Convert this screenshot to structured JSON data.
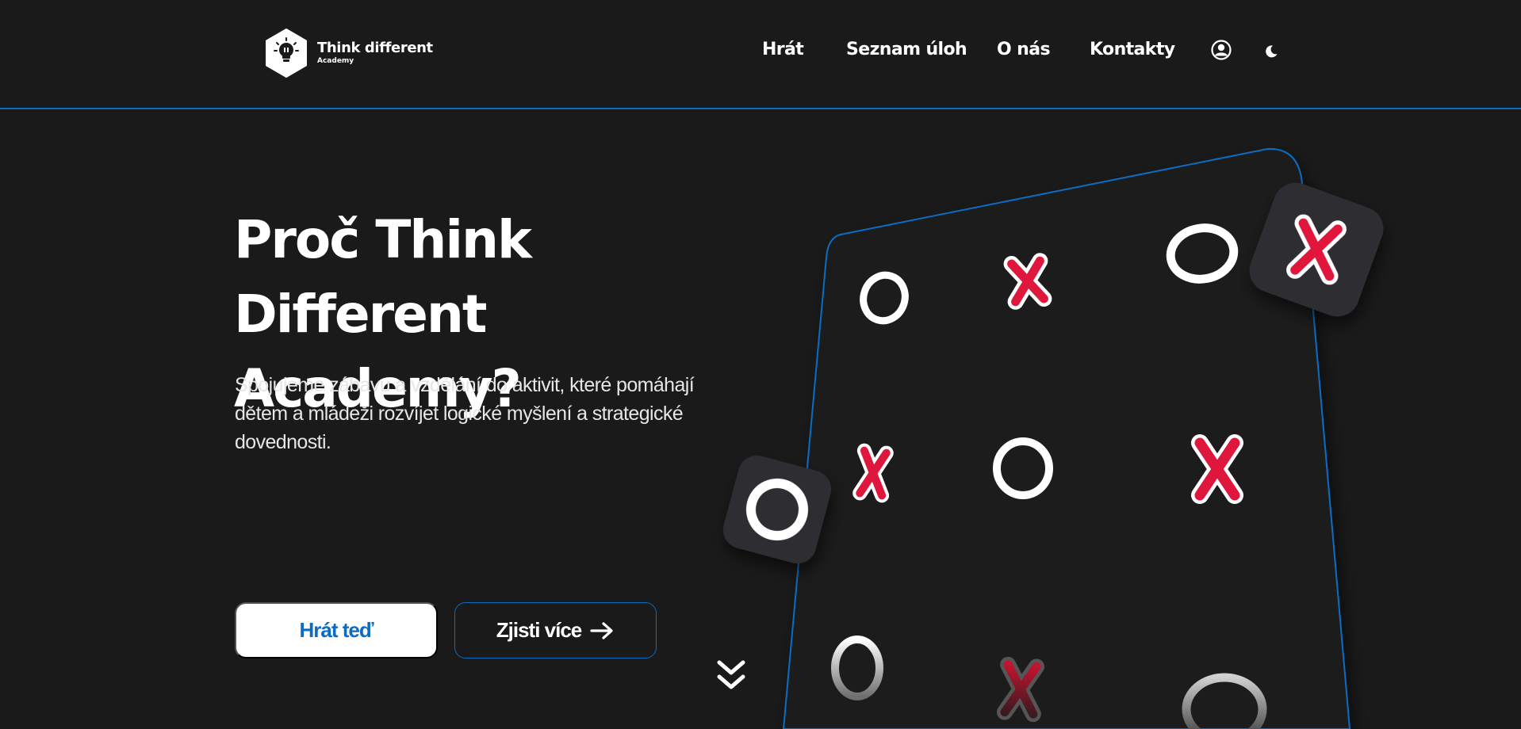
{
  "header": {
    "logo": {
      "title": "Think different",
      "subtitle": "Academy"
    },
    "nav": [
      {
        "label": "Hrát"
      },
      {
        "label": "Seznam úloh"
      },
      {
        "label": "O nás"
      },
      {
        "label": "Kontakty"
      }
    ],
    "icons": {
      "account": "user-circle-icon",
      "theme": "moon-icon"
    }
  },
  "hero": {
    "title_line1": "Proč Think Different",
    "title_line2": "Academy?",
    "text_line1": "Spojujeme zábavu a vzdělání do aktivit, které pomáhají",
    "text_line2": "dětem a mládeži rozvíjet logické myšlení a strategické",
    "text_line3": "dovednosti.",
    "primary_button": "Hrát teď",
    "secondary_button": "Zjisti více"
  },
  "colors": {
    "background": "#1a1a1b",
    "accent": "#0a6cc2",
    "x_mark": "#e0173d",
    "tile": "#2e2e30"
  }
}
